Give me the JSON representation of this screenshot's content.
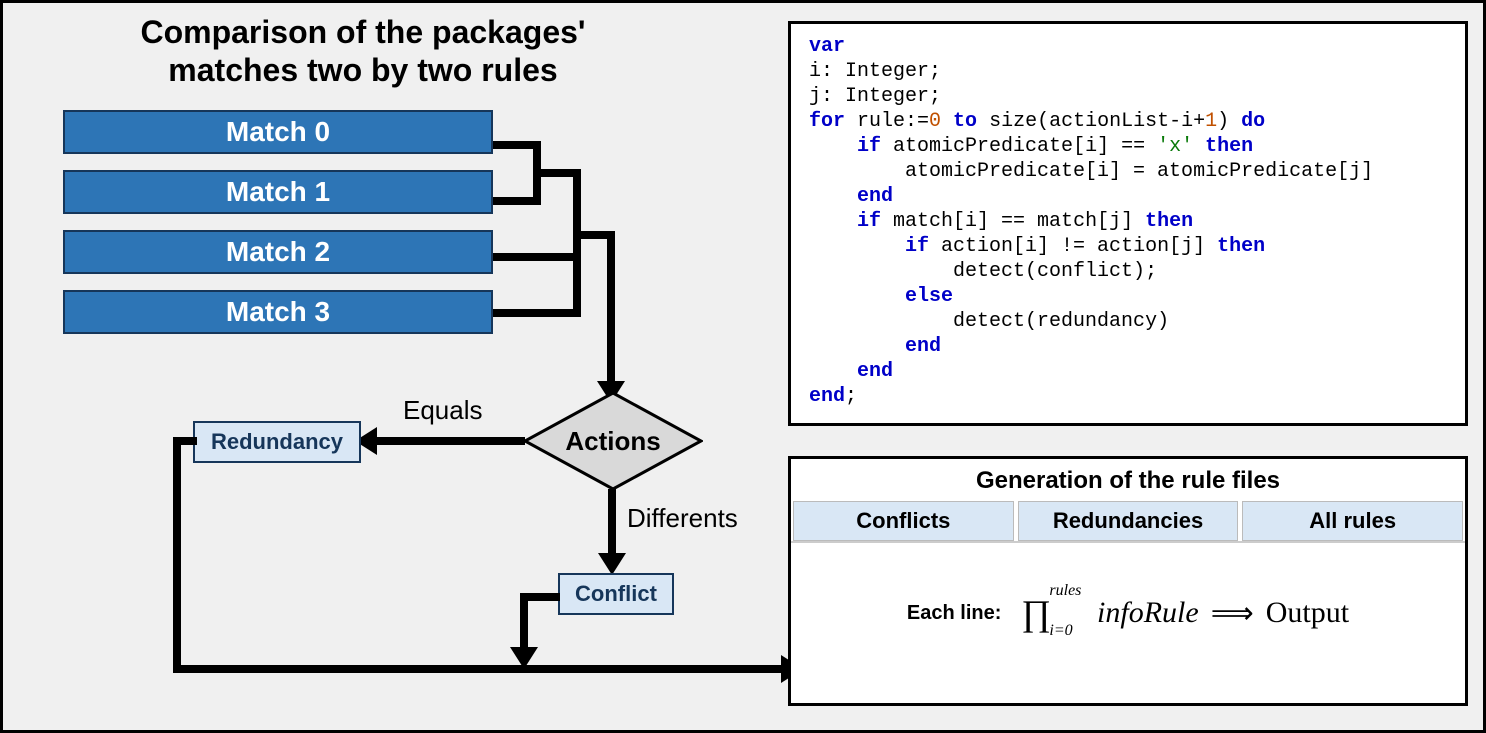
{
  "diagram": {
    "title_line1": "Comparison of the packages'",
    "title_line2": "matches two by two rules",
    "matches": [
      "Match 0",
      "Match 1",
      "Match 2",
      "Match 3"
    ],
    "decision": "Actions",
    "equals_label": "Equals",
    "differents_label": "Differents",
    "redundancy_box": "Redundancy",
    "conflict_box": "Conflict"
  },
  "code": {
    "l1": "var",
    "l2": "i: Integer;",
    "l3": "j: Integer;",
    "l4a": "for",
    "l4b": " rule:=",
    "l4c": "0",
    "l4d": " to",
    "l4e": " size(actionList-i+",
    "l4f": "1",
    "l4g": ") ",
    "l4h": "do",
    "l5a": "if",
    "l5b": " atomicPredicate[i] == ",
    "l5c": "'x'",
    "l5d": " then",
    "l6": "atomicPredicate[i] = atomicPredicate[j]",
    "l7": "end",
    "l8a": "if",
    "l8b": " match[i] == match[j] ",
    "l8c": "then",
    "l9a": "if",
    "l9b": " action[i] != action[j] ",
    "l9c": "then",
    "l10": "detect(conflict);",
    "l11": "else",
    "l12": "detect(redundancy)",
    "l13": "end",
    "l14": "end",
    "l15": "end",
    "l16": ";"
  },
  "gen": {
    "title": "Generation of the rule files",
    "tabs": [
      "Conflicts",
      "Redundancies",
      "All rules"
    ],
    "each_line": "Each line:",
    "prod_sup": "rules",
    "prod_sub": "i=0",
    "inforule": "infoRule",
    "implies": "⟹",
    "output": "Output"
  }
}
